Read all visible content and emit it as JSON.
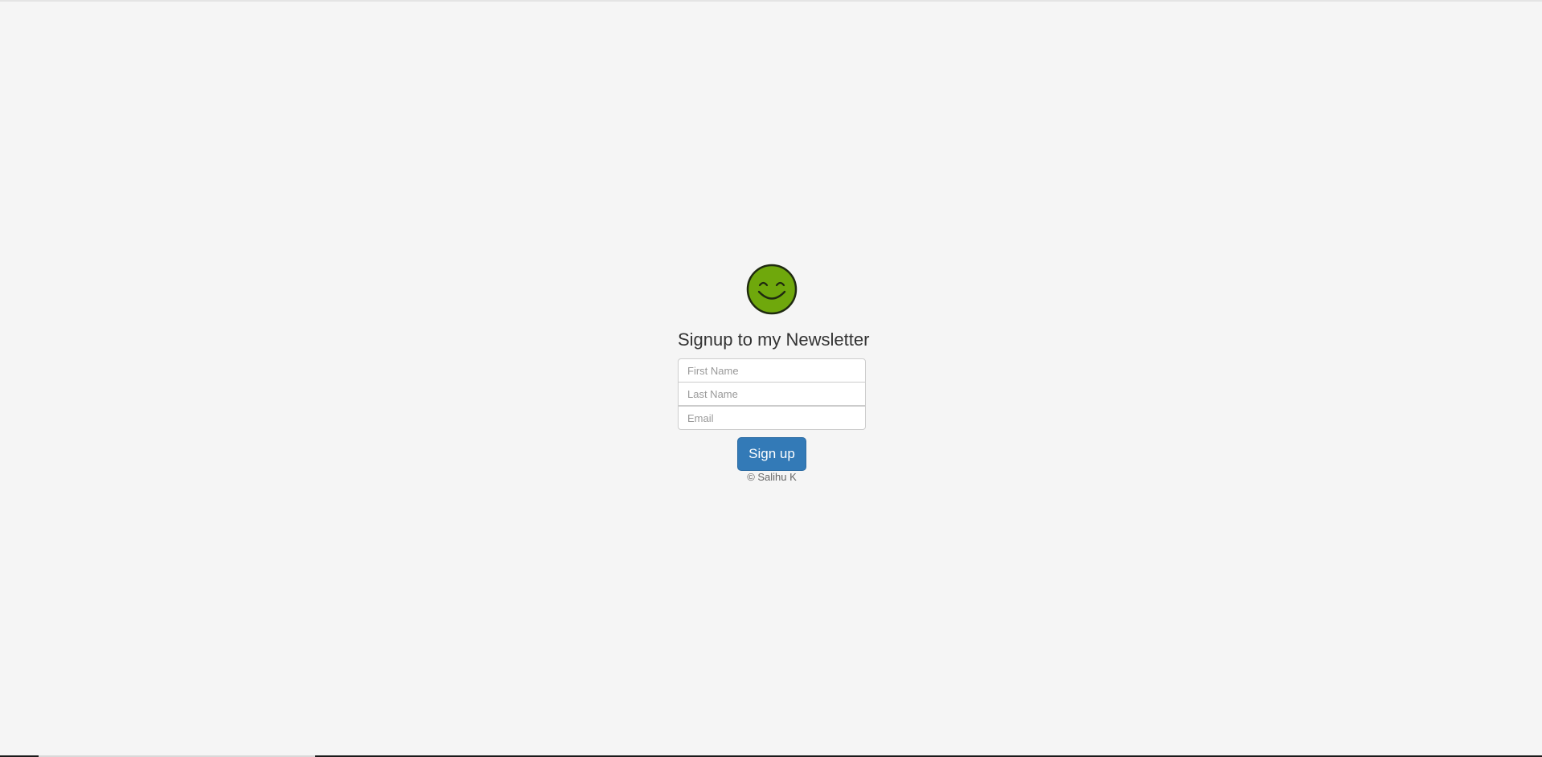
{
  "form": {
    "title": "Signup to my Newsletter",
    "first_name_placeholder": "First Name",
    "last_name_placeholder": "Last Name",
    "email_placeholder": "Email",
    "submit_label": "Sign up",
    "footer": "© Salihu K"
  },
  "logo": {
    "icon": "smiley-face-icon",
    "fill_color": "#6fa80c",
    "stroke_color": "#1f2a10"
  },
  "colors": {
    "background": "#f5f5f5",
    "button": "#337ab7",
    "heading_text": "#333333"
  }
}
